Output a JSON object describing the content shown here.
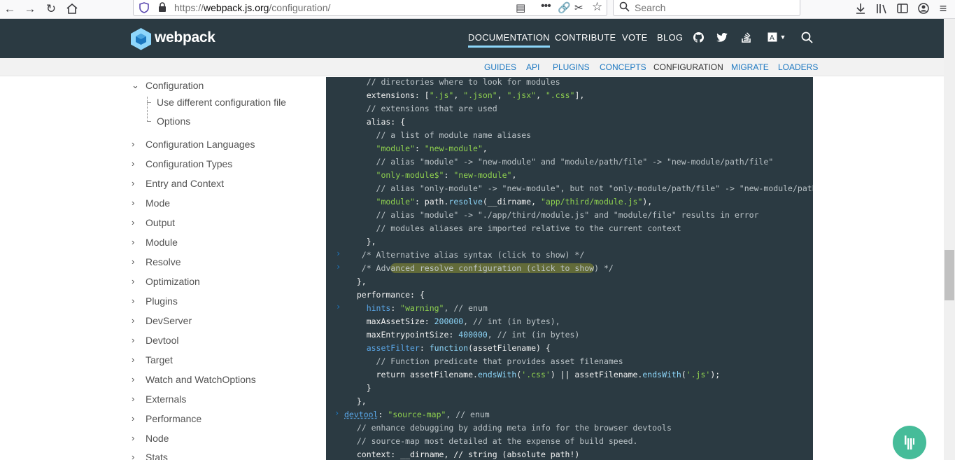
{
  "browser": {
    "url_prefix": "https://",
    "url_host": "webpack.js.org",
    "url_path": "/configuration/",
    "search_placeholder": "Search"
  },
  "site": {
    "logo_text": "webpack",
    "nav": [
      "DOCUMENTATION",
      "CONTRIBUTE",
      "VOTE",
      "BLOG"
    ],
    "subnav": [
      "GUIDES",
      "API",
      "PLUGINS",
      "CONCEPTS",
      "CONFIGURATION",
      "MIGRATE",
      "LOADERS"
    ]
  },
  "sidebar": {
    "open": "Configuration",
    "sub": [
      "Use different configuration file",
      "Options"
    ],
    "items": [
      "Configuration Languages",
      "Configuration Types",
      "Entry and Context",
      "Mode",
      "Output",
      "Module",
      "Resolve",
      "Optimization",
      "Plugins",
      "DevServer",
      "Devtool",
      "Target",
      "Watch and WatchOptions",
      "Externals",
      "Performance",
      "Node",
      "Stats"
    ]
  },
  "code": {
    "l1": "    // directories where to look for modules",
    "l2a": "    extensions: [",
    "l2b": "\".js\"",
    "l2c": ", ",
    "l2d": "\".json\"",
    "l2e": ", ",
    "l2f": "\".jsx\"",
    "l2g": ", ",
    "l2h": "\".css\"",
    "l2i": "],",
    "l3": "    // extensions that are used",
    "l4": "    alias: {",
    "l5": "      // a list of module name aliases",
    "l6a": "      \"module\"",
    "l6b": ": ",
    "l6c": "\"new-module\"",
    "l6d": ",",
    "l7": "      // alias \"module\" -> \"new-module\" and \"module/path/file\" -> \"new-module/path/file\"",
    "l8a": "      \"only-module$\"",
    "l8b": ": ",
    "l8c": "\"new-module\"",
    "l8d": ",",
    "l9": "      // alias \"only-module\" -> \"new-module\", but not \"only-module/path/file\" -> \"new-module/path/file\"",
    "l10a": "      \"module\"",
    "l10b": ": path.",
    "l10c": "resolve",
    "l10d": "(__dirname, ",
    "l10e": "\"app/third/module.js\"",
    "l10f": "),",
    "l11": "      // alias \"module\" -> \"./app/third/module.js\" and \"module/file\" results in error",
    "l12": "      // modules aliases are imported relative to the current context",
    "l13": "    },",
    "l14": "   /* Alternative alias syntax (click to show) */",
    "l15a": "   /* Adv",
    "l15b": "anced resolve configuration (click to show",
    "l15c": ") */",
    "l16": "  },",
    "l17": "  performance: {",
    "l18a": "    hints",
    "l18b": ": ",
    "l18c": "\"warning\"",
    "l18d": ", // enum",
    "l19a": "    maxAssetSize: ",
    "l19b": "200000",
    "l19c": ", // int (in bytes),",
    "l20a": "    maxEntrypointSize: ",
    "l20b": "400000",
    "l20c": ", // int (in bytes)",
    "l21a": "    assetFilter",
    "l21b": ": ",
    "l21c": "function",
    "l21d": "(assetFilename) {",
    "l22": "      // Function predicate that provides asset filenames",
    "l23a": "      return assetFilename.",
    "l23b": "endsWith",
    "l23c": "(",
    "l23d": "'.css'",
    "l23e": ") || assetFilename.",
    "l23f": "endsWith",
    "l23g": "(",
    "l23h": "'.js'",
    "l23i": ");",
    "l24": "    }",
    "l25": "  },",
    "l26a": "devtool",
    "l26b": ": ",
    "l26c": "\"source-map\"",
    "l26d": ", // enum",
    "l27": "  // enhance debugging by adding meta info for the browser devtools",
    "l28": "  // source-map most detailed at the expense of build speed.",
    "l29": "  context: __dirname, // string (absolute path!)"
  }
}
